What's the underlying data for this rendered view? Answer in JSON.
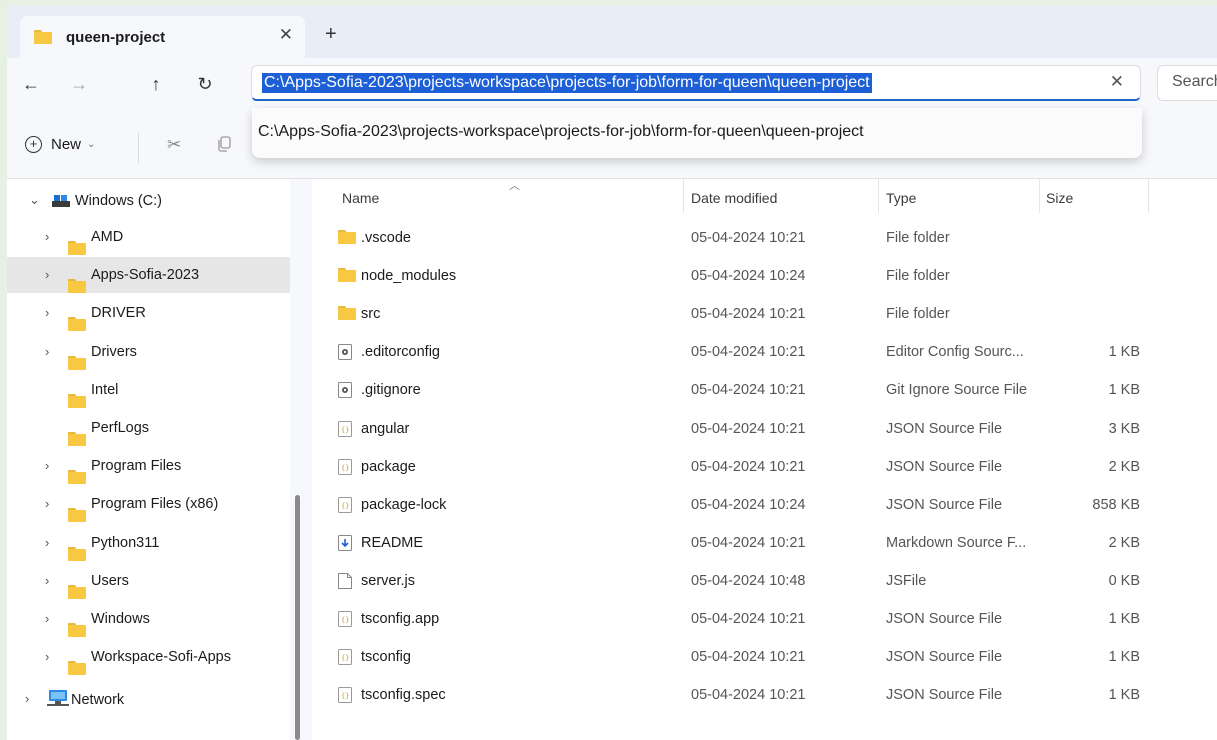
{
  "tab": {
    "title": "queen-project",
    "close": "✕",
    "new_tab": "+"
  },
  "nav": {
    "back": "←",
    "forward": "→",
    "up": "↑",
    "refresh": "↻"
  },
  "address": {
    "path": "C:\\Apps-Sofia-2023\\projects-workspace\\projects-for-job\\form-for-queen\\queen-project",
    "clear": "✕",
    "search_placeholder": "Search"
  },
  "suggestion": "C:\\Apps-Sofia-2023\\projects-workspace\\projects-for-job\\form-for-queen\\queen-project",
  "command_bar": {
    "new_label": "New",
    "new_chevron": "⌄",
    "cut": "✂"
  },
  "sidebar": {
    "drive": "Windows (C:)",
    "items": [
      {
        "label": "AMD",
        "expandable": true
      },
      {
        "label": "Apps-Sofia-2023",
        "expandable": true,
        "selected": true
      },
      {
        "label": "DRIVER",
        "expandable": true
      },
      {
        "label": "Drivers",
        "expandable": true
      },
      {
        "label": "Intel",
        "expandable": false
      },
      {
        "label": "PerfLogs",
        "expandable": false
      },
      {
        "label": "Program Files",
        "expandable": true
      },
      {
        "label": "Program Files (x86)",
        "expandable": true
      },
      {
        "label": "Python311",
        "expandable": true
      },
      {
        "label": "Users",
        "expandable": true
      },
      {
        "label": "Windows",
        "expandable": true
      },
      {
        "label": "Workspace-Sofi-Apps",
        "expandable": true
      }
    ],
    "network": "Network",
    "chevron_right": "›",
    "chevron_down": "⌄"
  },
  "columns": {
    "name": "Name",
    "date": "Date modified",
    "type": "Type",
    "size": "Size"
  },
  "files": [
    {
      "name": ".vscode",
      "date": "05-04-2024 10:21",
      "type": "File folder",
      "size": "",
      "icon": "folder-icon"
    },
    {
      "name": "node_modules",
      "date": "05-04-2024 10:24",
      "type": "File folder",
      "size": "",
      "icon": "folder-icon"
    },
    {
      "name": "src",
      "date": "05-04-2024 10:21",
      "type": "File folder",
      "size": "",
      "icon": "folder-icon"
    },
    {
      "name": ".editorconfig",
      "date": "05-04-2024 10:21",
      "type": "Editor Config Sourc...",
      "size": "1 KB",
      "icon": "config-file-icon"
    },
    {
      "name": ".gitignore",
      "date": "05-04-2024 10:21",
      "type": "Git Ignore Source File",
      "size": "1 KB",
      "icon": "config-file-icon"
    },
    {
      "name": "angular",
      "date": "05-04-2024 10:21",
      "type": "JSON Source File",
      "size": "3 KB",
      "icon": "json-file-icon"
    },
    {
      "name": "package",
      "date": "05-04-2024 10:21",
      "type": "JSON Source File",
      "size": "2 KB",
      "icon": "json-file-icon"
    },
    {
      "name": "package-lock",
      "date": "05-04-2024 10:24",
      "type": "JSON Source File",
      "size": "858 KB",
      "icon": "json-file-icon"
    },
    {
      "name": "README",
      "date": "05-04-2024 10:21",
      "type": "Markdown Source F...",
      "size": "2 KB",
      "icon": "markdown-file-icon"
    },
    {
      "name": "server.js",
      "date": "05-04-2024 10:48",
      "type": "JSFile",
      "size": "0 KB",
      "icon": "blank-file-icon"
    },
    {
      "name": "tsconfig.app",
      "date": "05-04-2024 10:21",
      "type": "JSON Source File",
      "size": "1 KB",
      "icon": "json-file-icon"
    },
    {
      "name": "tsconfig",
      "date": "05-04-2024 10:21",
      "type": "JSON Source File",
      "size": "1 KB",
      "icon": "json-file-icon"
    },
    {
      "name": "tsconfig.spec",
      "date": "05-04-2024 10:21",
      "type": "JSON Source File",
      "size": "1 KB",
      "icon": "json-file-icon"
    }
  ],
  "colors": {
    "accent": "#1d5fd6",
    "folder": "#f8c843",
    "selection": "#e6e6e6"
  }
}
